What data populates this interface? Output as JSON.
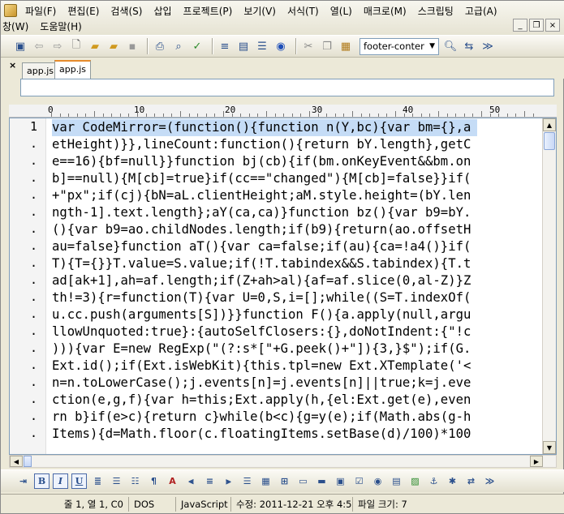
{
  "menu": {
    "row1": [
      "파일(F)",
      "편집(E)",
      "검색(S)",
      "삽입",
      "프로젝트(P)",
      "보기(V)",
      "서식(T)",
      "열(L)",
      "매크로(M)",
      "스크립팅",
      "고급(A)"
    ],
    "row2": [
      "창(W)",
      "도움말(H)"
    ],
    "mdi_buttons": [
      "_",
      "❐",
      "×"
    ]
  },
  "toolbar": {
    "combo_value": "footer-conter",
    "icons": [
      "toggle-icon",
      "back-icon",
      "forward-icon",
      "new-file-icon",
      "open-folder-icon",
      "open-icon",
      "save-icon",
      "print-icon",
      "print-preview-icon",
      "spellcheck-icon",
      "wrap-icon",
      "hex-icon",
      "list-icon",
      "browser-icon",
      "cut-icon",
      "copy-icon",
      "paste-icon",
      "find-icon",
      "replace-icon",
      "more-icon"
    ]
  },
  "tabs": [
    {
      "label": "app.js",
      "active": false
    },
    {
      "label": "app.js",
      "active": true
    }
  ],
  "ruler": {
    "marks": [
      "0",
      "10",
      "20",
      "30",
      "40",
      "50"
    ]
  },
  "editor": {
    "line_numbers": [
      "1",
      ".",
      ".",
      ".",
      ".",
      ".",
      ".",
      ".",
      ".",
      ".",
      ".",
      ".",
      ".",
      ".",
      ".",
      ".",
      ".",
      ".",
      "."
    ],
    "lines": [
      "var CodeMirror=(function(){function n(Y,bc){var bm={},a",
      "etHeight)}},lineCount:function(){return bY.length},getC",
      "e==16){bf=null}}function bj(cb){if(bm.onKeyEvent&&bm.on",
      "b]==null){M[cb]=true}if(cc==\"changed\"){M[cb]=false}}if(",
      "+\"px\";if(cj){bN=aL.clientHeight;aM.style.height=(bY.len",
      "ngth-1].text.length};aY(ca,ca)}function bz(){var b9=bY.",
      "(){var b9=ao.childNodes.length;if(b9){return(ao.offsetH",
      "au=false}function aT(){var ca=false;if(au){ca=!a4()}if(",
      "T){T={}}T.value=S.value;if(!T.tabindex&&S.tabindex){T.t",
      "ad[ak+1],ah=af.length;if(Z+ah>al){af=af.slice(0,al-Z)}Z",
      "th!=3){r=function(T){var U=0,S,i=[];while((S=T.indexOf(",
      "u.cc.push(arguments[S])}}function F(){a.apply(null,argu",
      "llowUnquoted:true}:{autoSelfClosers:{},doNotIndent:{\"!c",
      "))){var E=new RegExp(\"(?:s*[\"+G.peek()+\"]){3,}$\");if(G.",
      "Ext.id();if(Ext.isWebKit){this.tpl=new Ext.XTemplate('<",
      "n=n.toLowerCase();j.events[n]=j.events[n]||true;k=j.eve",
      "ction(e,g,f){var h=this;Ext.apply(h,{el:Ext.get(e),even",
      "rn b}if(e>c){return c}while(b<c){g=y(e);if(Math.abs(g-h",
      "Items){d=Math.floor(c.floatingItems.setBase(d)/100)*100"
    ]
  },
  "format_toolbar": {
    "icons": [
      "indent-icon",
      "bold-icon",
      "italic-icon",
      "underline-icon",
      "list-icon",
      "bullet-list-icon",
      "numbered-list-icon",
      "paragraph-icon",
      "font-color-icon",
      "align-left-icon",
      "align-center-icon",
      "align-right-icon",
      "align-justify-icon",
      "table-icon",
      "link-icon",
      "image-icon",
      "textbox-icon",
      "button-icon",
      "checkbox-icon",
      "radio-icon",
      "select-icon",
      "picture-icon",
      "anchor-icon",
      "special-char-icon",
      "convert-icon",
      "more-icon"
    ],
    "labels": {
      "bold": "B",
      "italic": "I",
      "underline": "U"
    }
  },
  "status": {
    "position": "줄 1, 열 1, C0",
    "line_ending": "DOS",
    "language": "JavaScript",
    "modified": "수정: 2011-12-21 오후 4:5",
    "file_size": "파일 크기: 7"
  }
}
